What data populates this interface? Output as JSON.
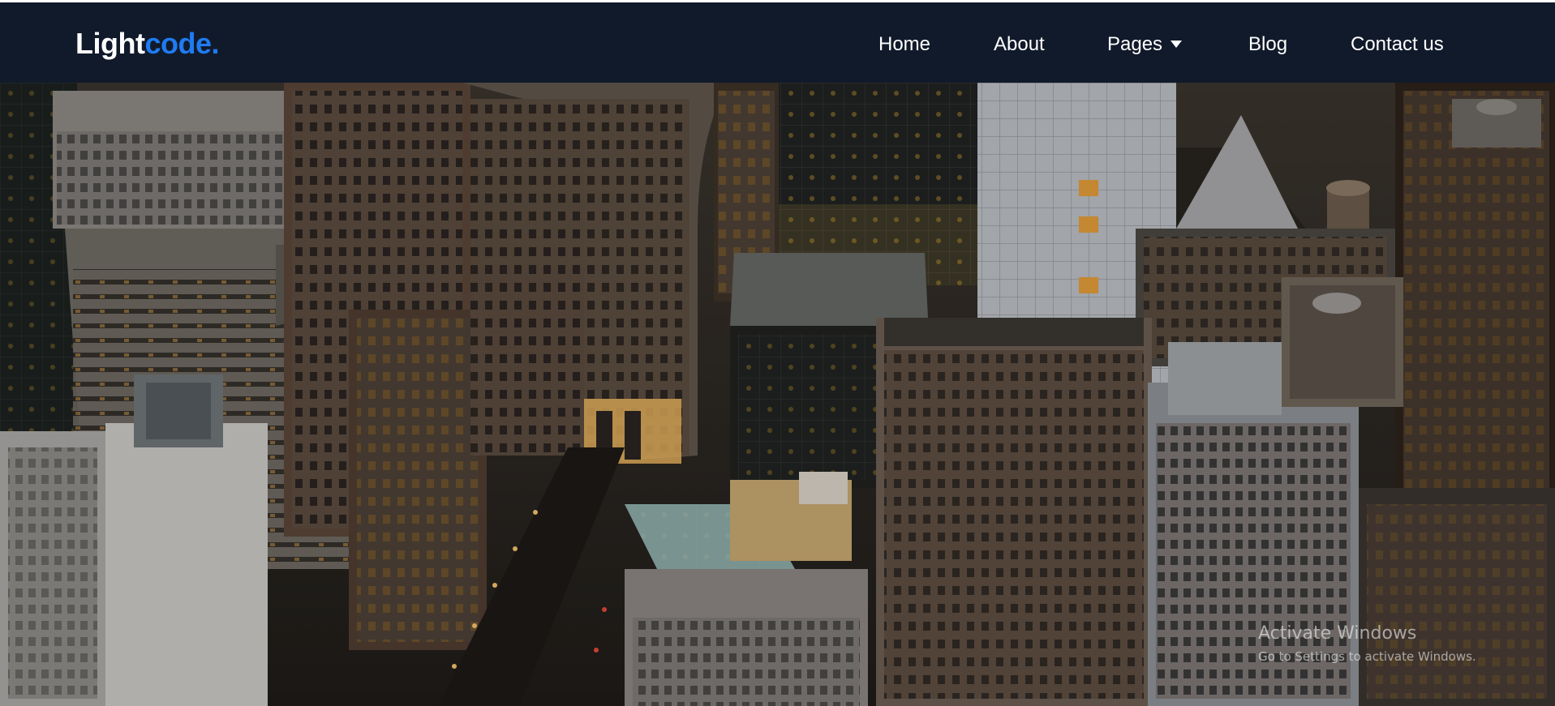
{
  "brand": {
    "part1": "Light",
    "part2": "code.",
    "colors": {
      "part1": "#ffffff",
      "part2": "#1f7bf2"
    }
  },
  "nav": {
    "items": [
      {
        "label": "Home"
      },
      {
        "label": "About"
      },
      {
        "label": "Pages",
        "icon": "chevron-down-icon"
      },
      {
        "label": "Blog"
      },
      {
        "label": "Contact us"
      }
    ]
  },
  "colors": {
    "navbar_bg": "#111a2a",
    "accent": "#1f7bf2"
  },
  "watermark": {
    "title": "Activate Windows",
    "subtitle": "Go to Settings to activate Windows."
  }
}
